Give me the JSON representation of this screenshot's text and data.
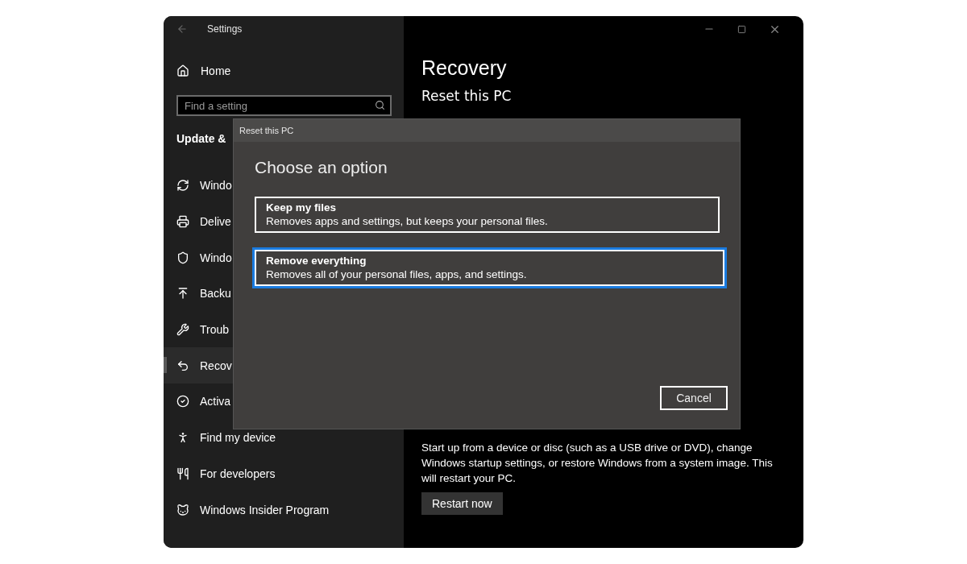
{
  "window": {
    "title": "Settings"
  },
  "sidebar": {
    "home": "Home",
    "search": {
      "placeholder": "Find a setting"
    },
    "section": "Update &",
    "items": [
      {
        "label": "Windo",
        "selected": false
      },
      {
        "label": "Delive",
        "selected": false
      },
      {
        "label": "Windo",
        "selected": false
      },
      {
        "label": "Backu",
        "selected": false
      },
      {
        "label": "Troub",
        "selected": false
      },
      {
        "label": "Recov",
        "selected": true
      },
      {
        "label": "Activa",
        "selected": false
      },
      {
        "label": "Find my device",
        "selected": false
      },
      {
        "label": "For developers",
        "selected": false
      },
      {
        "label": "Windows Insider Program",
        "selected": false
      }
    ]
  },
  "main": {
    "title": "Recovery",
    "heading": "Reset this PC",
    "paragraph": "Start up from a device or disc (such as a USB drive or DVD), change Windows startup settings, or restore Windows from a system image. This will restart your PC.",
    "button": "Restart now"
  },
  "dialog": {
    "title": "Reset this PC",
    "heading": "Choose an option",
    "options": [
      {
        "title": "Keep my files",
        "description": "Removes apps and settings, but keeps your personal files.",
        "selected": false
      },
      {
        "title": "Remove everything",
        "description": "Removes all of your personal files, apps, and settings.",
        "selected": true
      }
    ],
    "cancel": "Cancel"
  }
}
